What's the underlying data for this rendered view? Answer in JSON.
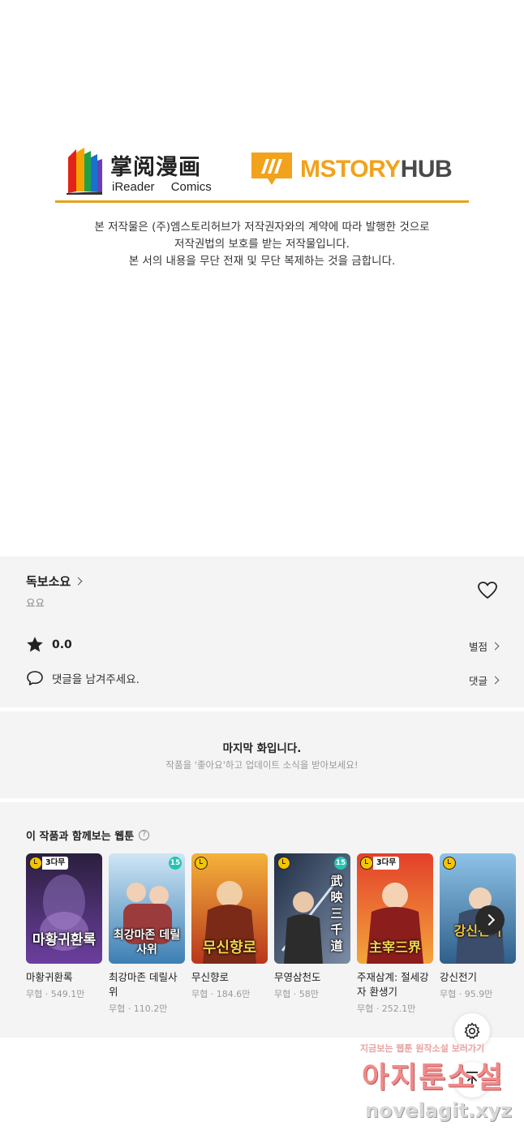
{
  "banner": {
    "ireader_cn": "掌阅漫画",
    "ireader_en": "iReader Comics",
    "mstory_part1": "MSTORY",
    "mstory_part2": "HUB",
    "copyright_lines": [
      "본 저작물은 (주)엠스토리허브가 저작권자와의 계약에 따라 발행한 것으로",
      "저작권법의 보호를 받는 저작물입니다.",
      "본 서의 내용을 무단 전재 및 무단 복제하는 것을 금합니다."
    ],
    "accent_color": "#e8a21c"
  },
  "info": {
    "title": "독보소요",
    "subtitle": "요요",
    "rating": "0.0",
    "rating_link": "별점",
    "comment_placeholder": "댓글을 남겨주세요.",
    "comment_link": "댓글"
  },
  "last_episode": {
    "title": "마지막 화입니다.",
    "subtitle": "작품을 '좋아요'하고 업데이트 소식을 받아보세요!"
  },
  "recommendations": {
    "header": "이 작품과 함께보는 웹툰",
    "items": [
      {
        "title": "마황귀환록",
        "meta": "무협 · 549.1만",
        "badge": "3다무",
        "cover_text": "마황귀환록"
      },
      {
        "title": "최강마존 데릴사위",
        "meta": "무협 · 110.2만",
        "age": "15",
        "cover_text": "최강마존 데릴사위"
      },
      {
        "title": "무신향로",
        "meta": "무협 · 184.6만",
        "cover_text": "무신향로"
      },
      {
        "title": "무영삼천도",
        "meta": "무협 · 58만",
        "age": "15",
        "cover_text": "武映三千道"
      },
      {
        "title": "주재삼계: 절세강자 환생기",
        "meta": "무협 · 252.1만",
        "badge": "3다무",
        "cover_text": "主宰三界"
      },
      {
        "title": "강신전기",
        "meta": "무협 · 95.9만",
        "cover_text": "강신전기"
      }
    ]
  },
  "watermark": {
    "top": "지금보는 웹툰 원작소설 보러가기",
    "mid": "아지툰소설",
    "bottom": "novelagit.xyz"
  }
}
